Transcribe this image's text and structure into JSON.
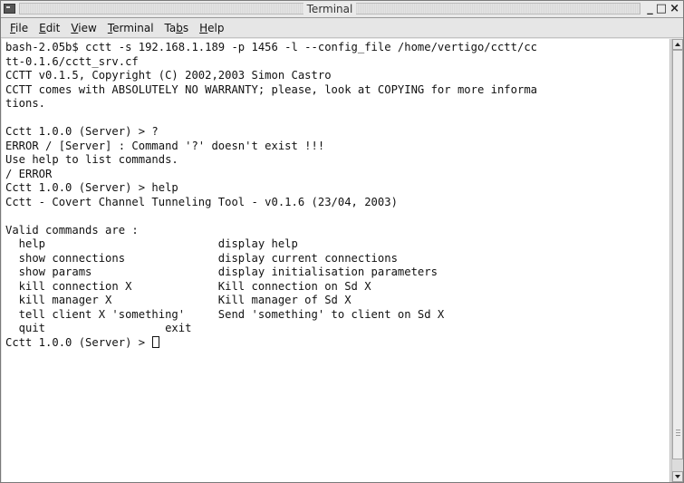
{
  "window": {
    "title": "Terminal",
    "controls": {
      "minimize": "_",
      "maximize": "□",
      "close": "×"
    }
  },
  "menu": {
    "items": [
      {
        "underline": "F",
        "rest": "ile"
      },
      {
        "underline": "E",
        "rest": "dit"
      },
      {
        "underline": "V",
        "rest": "iew"
      },
      {
        "underline": "T",
        "rest": "erminal"
      },
      {
        "prefix": "Ta",
        "underline": "b",
        "rest": "s"
      },
      {
        "underline": "H",
        "rest": "elp"
      }
    ]
  },
  "terminal": {
    "lines": [
      "bash-2.05b$ cctt -s 192.168.1.189 -p 1456 -l --config_file /home/vertigo/cctt/cc",
      "tt-0.1.6/cctt_srv.cf",
      "CCTT v0.1.5, Copyright (C) 2002,2003 Simon Castro",
      "CCTT comes with ABSOLUTELY NO WARRANTY; please, look at COPYING for more informa",
      "tions.",
      "",
      "Cctt 1.0.0 (Server) > ?",
      "ERROR / [Server] : Command '?' doesn't exist !!!",
      "Use help to list commands.",
      "/ ERROR",
      "Cctt 1.0.0 (Server) > help",
      "Cctt - Covert Channel Tunneling Tool - v0.1.6 (23/04, 2003)",
      "",
      "Valid commands are :",
      "  help                          display help",
      "  show connections              display current connections",
      "  show params                   display initialisation parameters",
      "  kill connection X             Kill connection on Sd X",
      "  kill manager X                Kill manager of Sd X",
      "  tell client X 'something'     Send 'something' to client on Sd X",
      "  quit                  exit"
    ],
    "prompt": "Cctt 1.0.0 (Server) > "
  }
}
